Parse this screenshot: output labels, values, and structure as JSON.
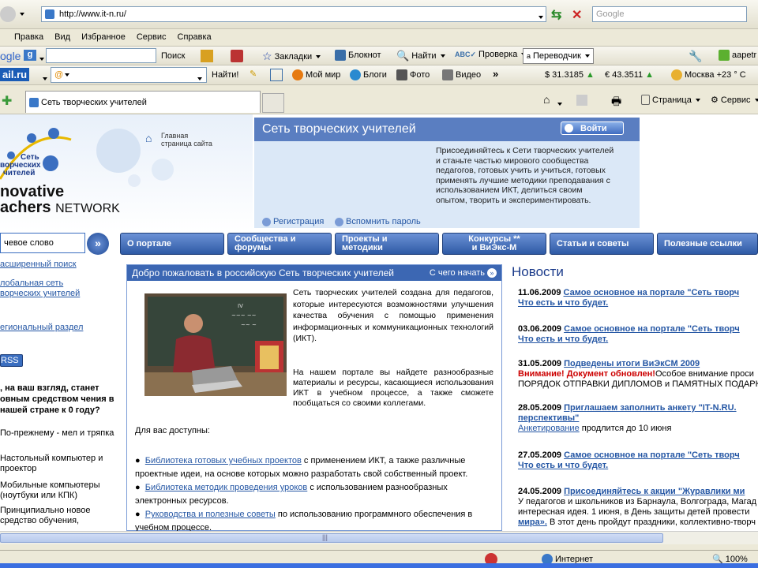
{
  "browser": {
    "url": "http://www.it-n.ru/",
    "search_placeholder": "Google",
    "menu": [
      "Правка",
      "Вид",
      "Избранное",
      "Сервис",
      "Справка"
    ],
    "toolbar1": {
      "google_logo": "ogle",
      "search": "Поиск",
      "bookmarks": "Закладки",
      "notepad": "Блокнот",
      "find": "Найти",
      "check": "Проверка",
      "translator": "Переводчик",
      "user": "aapetr"
    },
    "toolbar2": {
      "mail_logo": "ail.ru",
      "find_btn": "Найти!",
      "myworld": "Мой мир",
      "blogs": "Блоги",
      "photo": "Фото",
      "video": "Видео",
      "usd": "$ 31.3185",
      "eur": "€ 43.3511",
      "weather": "Москва +23 ° C"
    },
    "tab_title": "Сеть творческих учителей",
    "tab_tools": {
      "page": "Страница",
      "service": "Сервис"
    },
    "status": {
      "zone": "Интернет",
      "zoom": "100%"
    }
  },
  "site": {
    "logo_line1": "Сеть",
    "logo_line2": "ворческих",
    "logo_line3": "чителей",
    "logo_en1": "novative",
    "logo_en2": "achers",
    "logo_en3": "NETWORK",
    "home_link1": "Главная",
    "home_link2": "страница сайта",
    "header_title": "Сеть творческих учителей",
    "login": "Войти",
    "register": "Регистрация",
    "remember": "Вспомнить пароль",
    "join_text": "Присоединяйтесь к Сети творческих учителей и станьте частью мирового сообщества педагогов, готовых учить и учиться, готовых применять лучшие методики преподавания с использованием ИКТ, делиться своим опытом, творить и экспериментировать.",
    "keyword_placeholder": "чевое слово",
    "nav": [
      {
        "l1": "О портале",
        "l2": ""
      },
      {
        "l1": "Сообщества и",
        "l2": "форумы"
      },
      {
        "l1": "Проекты и",
        "l2": "методики"
      },
      {
        "l1": "Конкурсы **",
        "l2": "и ВиЭкс-М"
      },
      {
        "l1": "Статьи и советы",
        "l2": ""
      },
      {
        "l1": "Полезные ссылки",
        "l2": ""
      }
    ],
    "left": {
      "adv_search": "асширенный поиск",
      "global1": "лобальная сеть",
      "global2": "ворческих учителей",
      "regional": "егиональный раздел",
      "rss": "RSS",
      "poll_q": ", на ваш взгляд, станет овным средством чения в нашей стране к 0 году?",
      "opt1": "По-прежнему - мел и тряпка",
      "opt2": "Настольный компьютер и проектор",
      "opt3": "Мобильные компьютеры (ноутбуки или КПК)",
      "opt4": "Принципиально новое средство обучения,"
    },
    "welcome": {
      "title": "Добро пожаловать в российскую Сеть творческих учителей",
      "start": "С чего начать",
      "p1": "Сеть творческих учителей создана для педагогов, которые интересуются возможностями улучшения качества обучения с помощью применения информационных и коммуникационных технологий (ИКТ).",
      "p2": "На нашем портале вы найдете разнообразные материалы и ресурсы, касающиеся использования ИКТ в учебном процессе, а также сможете пообщаться со своими коллегами.",
      "avail": "Для вас доступны:",
      "b1_link": "Библиотека готовых учебных проектов",
      "b1_text": " с применением ИКТ, а также различные проектные идеи, на основе которых можно разработать свой собственный проект.",
      "b2_link": "Библиотека методик проведения уроков",
      "b2_text": " с использованием разнообразных электронных ресурсов.",
      "b3_link": "Руководства и полезные советы",
      "b3_text": " по использованию программного обеспечения в учебном процессе."
    },
    "news": {
      "title": "Новости",
      "items": [
        {
          "date": "11.06.2009",
          "title": "Самое основное на портале \"Сеть творч",
          "title2": "Что есть и что будет.",
          "extra": ""
        },
        {
          "date": "03.06.2009",
          "title": "Самое основное на портале \"Сеть творч",
          "title2": "Что есть и что будет.",
          "extra": ""
        },
        {
          "date": "31.05.2009",
          "title": "Подведены итоги ВиЭкСМ 2009",
          "title2": "",
          "warn": "Внимание! Документ обновлен!",
          "extra": "Особое внимание проси",
          "extra2": "ПОРЯДОК ОТПРАВКИ ДИПЛОМОВ и ПАМЯТНЫХ ПОДАРКОВ"
        },
        {
          "date": "28.05.2009",
          "title": "Приглашаем заполнить анкету \"IT-N.RU.",
          "title2": "перспективы\"",
          "link3": "Анкетирование",
          "extra": " продлится до 10 июня"
        },
        {
          "date": "27.05.2009",
          "title": "Самое основное на портале \"Сеть творч",
          "title2": "Что есть и что будет.",
          "extra": ""
        },
        {
          "date": "24.05.2009",
          "title": "Присоединяйтесь к акции \"Журавлики ми",
          "title2": "",
          "extra": "У педагогов и школьников из Барнаула, Волгограда, Магад",
          "extra2": "интересная идея. 1 июня, в День защиты детей провести ",
          "link3": "мира».",
          "extra3": " В этот день пройдут праздники, коллективно-творч"
        }
      ]
    }
  }
}
